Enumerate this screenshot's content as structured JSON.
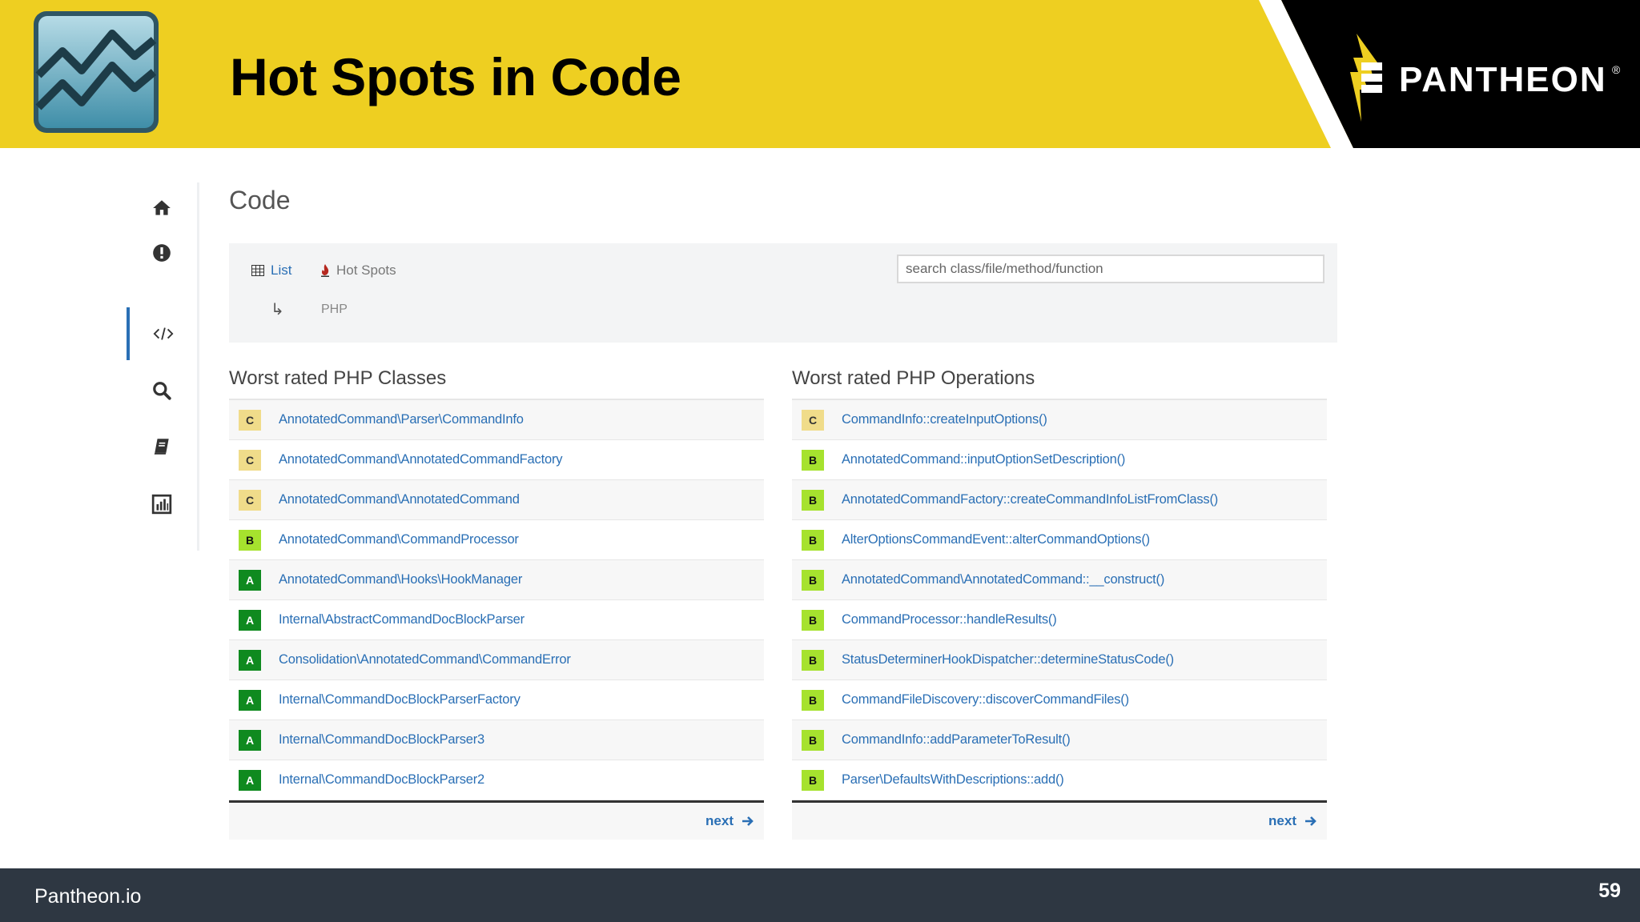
{
  "slide": {
    "title": "Hot Spots in Code",
    "brand_name": "PANTHEON",
    "brand_reg": "®",
    "footer_site": "Pantheon.io",
    "page_number": "59"
  },
  "colors": {
    "header_yellow": "#eecf21",
    "footer_dark": "#2e3742",
    "link_blue": "#2a6fb5",
    "grade_a": "#0f8a1f",
    "grade_b": "#a6e22e",
    "grade_c": "#f0dc8a"
  },
  "sidebar": {
    "items": [
      {
        "icon": "home-icon"
      },
      {
        "icon": "alert-icon"
      },
      {
        "icon": "code-icon",
        "active": true
      },
      {
        "icon": "search-icon"
      },
      {
        "icon": "book-icon"
      },
      {
        "icon": "chart-icon"
      }
    ]
  },
  "page": {
    "heading": "Code",
    "list_label": "List",
    "hotspots_label": "Hot Spots",
    "sub_arrow": "↳",
    "language": "PHP",
    "search_placeholder": "search class/file/method/function"
  },
  "classes_panel": {
    "title": "Worst rated PHP Classes",
    "rows": [
      {
        "grade": "C",
        "name": "AnnotatedCommand\\Parser\\CommandInfo"
      },
      {
        "grade": "C",
        "name": "AnnotatedCommand\\AnnotatedCommandFactory"
      },
      {
        "grade": "C",
        "name": "AnnotatedCommand\\AnnotatedCommand"
      },
      {
        "grade": "B",
        "name": "AnnotatedCommand\\CommandProcessor"
      },
      {
        "grade": "A",
        "name": "AnnotatedCommand\\Hooks\\HookManager"
      },
      {
        "grade": "A",
        "name": "Internal\\AbstractCommandDocBlockParser"
      },
      {
        "grade": "A",
        "name": "Consolidation\\AnnotatedCommand\\CommandError"
      },
      {
        "grade": "A",
        "name": "Internal\\CommandDocBlockParserFactory"
      },
      {
        "grade": "A",
        "name": "Internal\\CommandDocBlockParser3"
      },
      {
        "grade": "A",
        "name": "Internal\\CommandDocBlockParser2"
      }
    ],
    "next_label": "next"
  },
  "operations_panel": {
    "title": "Worst rated PHP Operations",
    "rows": [
      {
        "grade": "C",
        "name": "CommandInfo::createInputOptions()"
      },
      {
        "grade": "B",
        "name": "AnnotatedCommand::inputOptionSetDescription()"
      },
      {
        "grade": "B",
        "name": "AnnotatedCommandFactory::createCommandInfoListFromClass()"
      },
      {
        "grade": "B",
        "name": "AlterOptionsCommandEvent::alterCommandOptions()"
      },
      {
        "grade": "B",
        "name": "AnnotatedCommand\\AnnotatedCommand::__construct()"
      },
      {
        "grade": "B",
        "name": "CommandProcessor::handleResults()"
      },
      {
        "grade": "B",
        "name": "StatusDeterminerHookDispatcher::determineStatusCode()"
      },
      {
        "grade": "B",
        "name": "CommandFileDiscovery::discoverCommandFiles()"
      },
      {
        "grade": "B",
        "name": "CommandInfo::addParameterToResult()"
      },
      {
        "grade": "B",
        "name": "Parser\\DefaultsWithDescriptions::add()"
      }
    ],
    "next_label": "next"
  }
}
